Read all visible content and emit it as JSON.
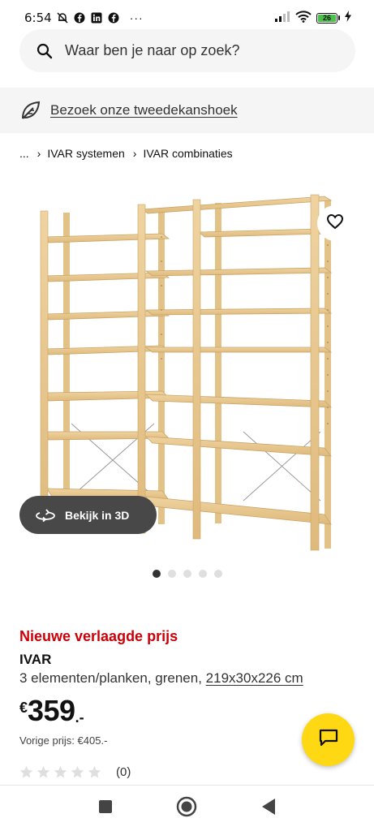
{
  "status_bar": {
    "time": "6:54",
    "battery_level": "26",
    "icons": [
      "muted-bell-icon",
      "facebook-icon",
      "linkedin-icon",
      "facebook-icon",
      "more-dots-icon",
      "signal-icon",
      "wifi-icon",
      "battery-icon",
      "charging-icon"
    ],
    "more": "···"
  },
  "search": {
    "placeholder": "Waar ben je naar op zoek?"
  },
  "promo": {
    "link_text": "Bezoek onze tweedekanshoek"
  },
  "breadcrumb": {
    "ellipsis": "...",
    "items": [
      "IVAR systemen",
      "IVAR combinaties"
    ],
    "separator": "›"
  },
  "gallery": {
    "view_3d_label": "Bekijk in 3D",
    "dot_count": 5,
    "active_dot": 0
  },
  "product": {
    "price_label": "Nieuwe verlaagde prijs",
    "name": "IVAR",
    "description": "3 elementen/planken, grenen, ",
    "dimensions": "219x30x226 cm",
    "currency": "€",
    "price_integer": "359",
    "price_suffix": ".-",
    "previous_price": "Vorige prijs: €405.-",
    "rating_stars": 0,
    "rating_max": 5,
    "rating_count": "(0)"
  },
  "colors": {
    "accent_red": "#cc0008",
    "chat_yellow": "#ffd814",
    "dark_button": "#484848",
    "wood": "#e9c990"
  }
}
